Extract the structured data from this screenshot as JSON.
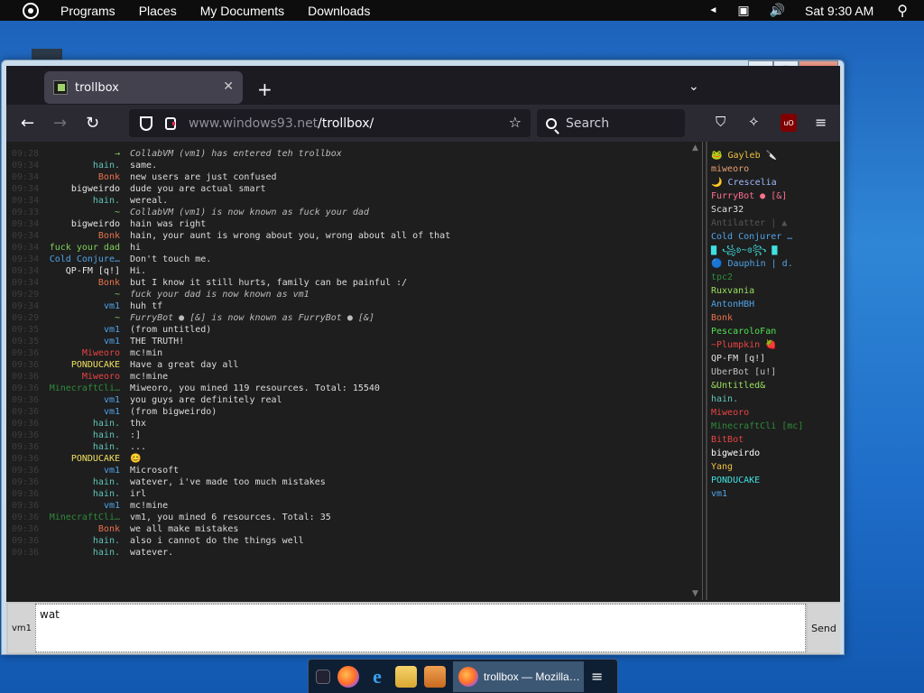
{
  "top_panel": {
    "menus": [
      "Programs",
      "Places",
      "My Documents",
      "Downloads"
    ],
    "volume_indicator": "◄",
    "clock": "Sat 9:30 AM"
  },
  "window": {
    "controls": {
      "minimize": "—",
      "maximize": "▢",
      "close": "✕"
    }
  },
  "browser": {
    "tab_title": "trollbox",
    "new_tab": "+",
    "tab_list": "⌄",
    "url_domain": "www.windows93.net",
    "url_path": "/trollbox/",
    "search_placeholder": "Search",
    "ublock_label": "uO"
  },
  "chat": {
    "messages": [
      {
        "time": "09:28",
        "nick": "→",
        "nick_color": "#7fd05a",
        "text": "CollabVM (vm1) has entered teh trollbox",
        "system": true
      },
      {
        "time": "09:34",
        "nick": "hain.",
        "nick_color": "#5fc4b8",
        "text": "same."
      },
      {
        "time": "09:34",
        "nick": "Bonk",
        "nick_color": "#e8734c",
        "text": "new users are just confused"
      },
      {
        "time": "09:34",
        "nick": "bigweirdo",
        "nick_color": "#e8e8e8",
        "text": "dude you are actual smart"
      },
      {
        "time": "09:34",
        "nick": "hain.",
        "nick_color": "#5fc4b8",
        "text": "wereal."
      },
      {
        "time": "09:33",
        "nick": "~",
        "nick_color": "#7fd05a",
        "text": "CollabVM (vm1) is now known as fuck your dad",
        "system": true
      },
      {
        "time": "09:34",
        "nick": "bigweirdo",
        "nick_color": "#e8e8e8",
        "text": "hain was right"
      },
      {
        "time": "09:34",
        "nick": "Bonk",
        "nick_color": "#e8734c",
        "text": "hain, your aunt is wrong about you, wrong about all of that"
      },
      {
        "time": "09:34",
        "nick": "fuck your dad",
        "nick_color": "#7fd05a",
        "text": "hi"
      },
      {
        "time": "09:34",
        "nick": "Cold Conjure…",
        "nick_color": "#4fa3e8",
        "text": "Don't touch me."
      },
      {
        "time": "09:34",
        "nick": "QP-FM [q!]",
        "nick_color": "#e8e8e8",
        "text": "Hi."
      },
      {
        "time": "09:34",
        "nick": "Bonk",
        "nick_color": "#e8734c",
        "text": "but I know it still hurts, family can be painful :/"
      },
      {
        "time": "09:29",
        "nick": "~",
        "nick_color": "#7fd05a",
        "text": "fuck your dad is now known as vm1",
        "system": true
      },
      {
        "time": "09:34",
        "nick": "vm1",
        "nick_color": "#4fa3e8",
        "text": "huh tf"
      },
      {
        "time": "09:29",
        "nick": "~",
        "nick_color": "#7fd05a",
        "text": "FurryBot ● [&] is now known as FurryBot ● [&]",
        "system": true
      },
      {
        "time": "09:35",
        "nick": "vm1",
        "nick_color": "#4fa3e8",
        "text": "(from untitled)"
      },
      {
        "time": "09:35",
        "nick": "vm1",
        "nick_color": "#4fa3e8",
        "text": "THE TRUTH!"
      },
      {
        "time": "09:36",
        "nick": "Miweoro",
        "nick_color": "#e84444",
        "text": "mc!min"
      },
      {
        "time": "09:36",
        "nick": "PONDUCAKE",
        "nick_color": "#f0e060",
        "text": "Have a great day all"
      },
      {
        "time": "09:36",
        "nick": "Miweoro",
        "nick_color": "#e84444",
        "text": "mc!mine"
      },
      {
        "time": "09:36",
        "nick": "MinecraftCli…",
        "nick_color": "#2e8b3a",
        "text": "Miweoro, you mined 119 resources. Total: 15540"
      },
      {
        "time": "09:36",
        "nick": "vm1",
        "nick_color": "#4fa3e8",
        "text": "you guys are definitely real"
      },
      {
        "time": "09:36",
        "nick": "vm1",
        "nick_color": "#4fa3e8",
        "text": "(from bigweirdo)"
      },
      {
        "time": "09:36",
        "nick": "hain.",
        "nick_color": "#5fc4b8",
        "text": "thx"
      },
      {
        "time": "09:36",
        "nick": "hain.",
        "nick_color": "#5fc4b8",
        "text": ":]"
      },
      {
        "time": "09:36",
        "nick": "hain.",
        "nick_color": "#5fc4b8",
        "text": "..."
      },
      {
        "time": "09:36",
        "nick": "PONDUCAKE",
        "nick_color": "#f0e060",
        "text": "😊"
      },
      {
        "time": "09:36",
        "nick": "vm1",
        "nick_color": "#4fa3e8",
        "text": "Microsoft"
      },
      {
        "time": "09:36",
        "nick": "hain.",
        "nick_color": "#5fc4b8",
        "text": "watever, i've made too much mistakes"
      },
      {
        "time": "09:36",
        "nick": "hain.",
        "nick_color": "#5fc4b8",
        "text": "irl"
      },
      {
        "time": "09:36",
        "nick": "vm1",
        "nick_color": "#4fa3e8",
        "text": "mc!mine"
      },
      {
        "time": "09:36",
        "nick": "MinecraftCli…",
        "nick_color": "#2e8b3a",
        "text": "vm1, you mined 6 resources. Total: 35"
      },
      {
        "time": "09:36",
        "nick": "Bonk",
        "nick_color": "#e8734c",
        "text": "we all make mistakes"
      },
      {
        "time": "09:36",
        "nick": "hain.",
        "nick_color": "#5fc4b8",
        "text": "also i cannot do the things well"
      },
      {
        "time": "09:36",
        "nick": "hain.",
        "nick_color": "#5fc4b8",
        "text": "watever."
      }
    ]
  },
  "users": [
    {
      "name": "🐸 Gayleb 🔪",
      "color": "#f0c040"
    },
    {
      "name": "miweoro",
      "color": "#e8a070"
    },
    {
      "name": "🌙 Crescelia",
      "color": "#a0b8ff"
    },
    {
      "name": "FurryBot ● [&]",
      "color": "#ff7090"
    },
    {
      "name": "Scar32",
      "color": "#e0e0e0"
    },
    {
      "name": "Antilatter | ▲",
      "color": "#555555"
    },
    {
      "name": "Cold Conjurer …",
      "color": "#4fa3e8"
    },
    {
      "name": "▇ ꧁ʚ~ɞ꧂ ▇",
      "color": "#40e0e0"
    },
    {
      "name": "🔵 Dauphin | d.",
      "color": "#4fa3e8"
    },
    {
      "name": "tpc2",
      "color": "#2e8b3a"
    },
    {
      "name": "Ruxvania",
      "color": "#9be060"
    },
    {
      "name": "AntonHBH",
      "color": "#4fa3e8"
    },
    {
      "name": "Bonk",
      "color": "#e8734c"
    },
    {
      "name": "PescaroloFan",
      "color": "#50e050"
    },
    {
      "name": "~Plumpkin 🍓",
      "color": "#e84444"
    },
    {
      "name": "QP-FM [q!]",
      "color": "#e0e0e0"
    },
    {
      "name": "UberBot [u!]",
      "color": "#c0c0c0"
    },
    {
      "name": "&Untitled&",
      "color": "#9be060"
    },
    {
      "name": "hain.",
      "color": "#5fc4b8"
    },
    {
      "name": "Miweoro",
      "color": "#e84444"
    },
    {
      "name": "MinecraftCli [mc]",
      "color": "#2e8b3a"
    },
    {
      "name": "BitBot",
      "color": "#e84444"
    },
    {
      "name": "bigweirdo",
      "color": "#ffffff"
    },
    {
      "name": "Yang",
      "color": "#f0c040"
    },
    {
      "name": "PONDUCAKE",
      "color": "#40e0e0"
    },
    {
      "name": "vm1",
      "color": "#4fa3e8"
    }
  ],
  "composer": {
    "nick_button": "vm1",
    "input_value": "wat",
    "send_label": "Send"
  },
  "taskbar": {
    "active_window": "trollbox — Mozilla…"
  }
}
